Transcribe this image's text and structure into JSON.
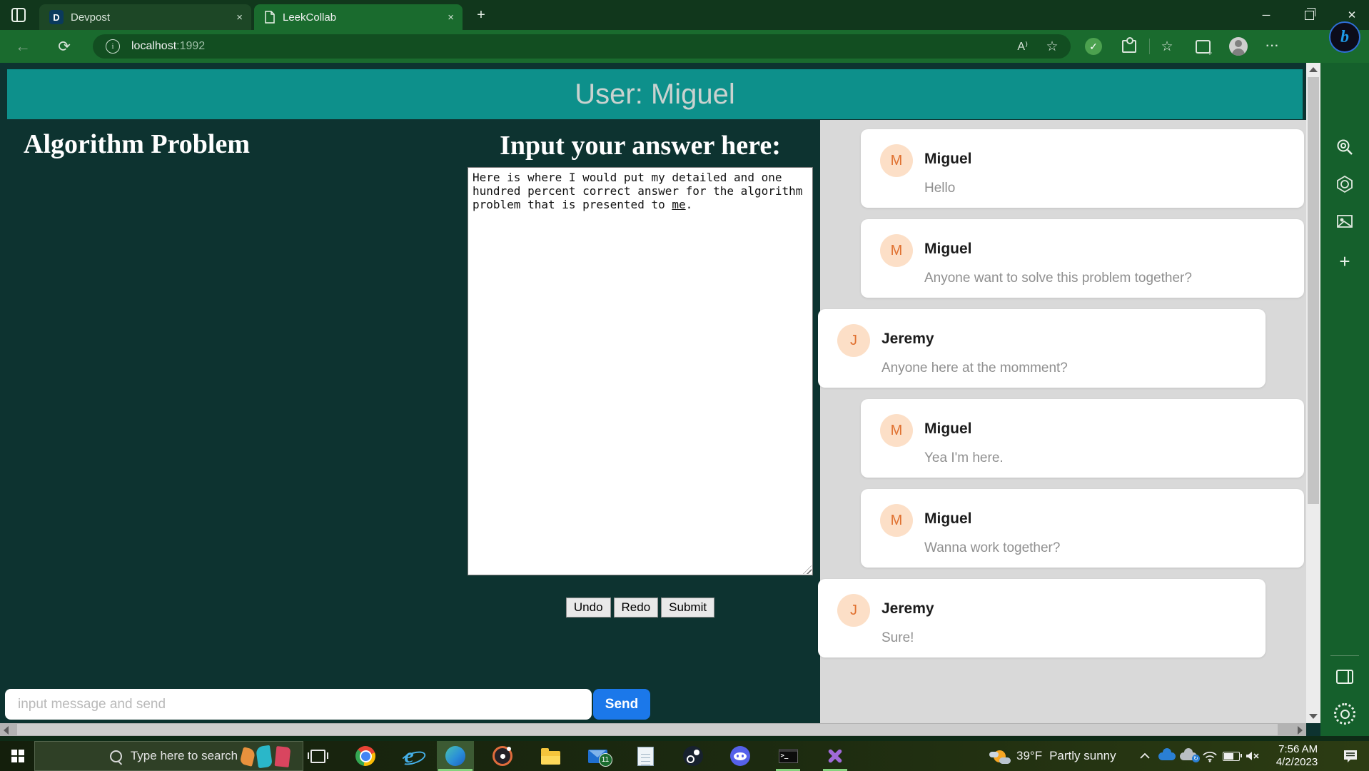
{
  "browser": {
    "tabs": [
      {
        "title": "Devpost",
        "favicon_letter": "D",
        "close": "×"
      },
      {
        "title": "LeekCollab",
        "close": "×"
      }
    ],
    "new_tab_label": "+",
    "url": {
      "host": "localhost",
      "port": ":1992"
    },
    "toolbar": {
      "back": "←",
      "refresh": "⟳",
      "read_aloud": "A⁾",
      "more_dots": "···",
      "bing_letter": "b",
      "check": "✓",
      "star": "☆",
      "star_list": "☆"
    },
    "window_controls": {
      "minimize": "─",
      "close": "✕"
    }
  },
  "page": {
    "user_header": "User: Miguel",
    "problem_title": "Algorithm Problem",
    "answer_heading": "Input your answer here:",
    "answer": {
      "before": "Here is where I would put my detailed and one hundred percent correct answer for the algorithm problem that is presented to ",
      "underlined": "me",
      "after": "."
    },
    "actions": {
      "undo": "Undo",
      "redo": "Redo",
      "submit": "Submit"
    },
    "chat_input": {
      "placeholder": "input message and send",
      "send": "Send"
    }
  },
  "chat": {
    "messages": [
      {
        "initial": "M",
        "author": "Miguel",
        "text": "Hello",
        "side": "right"
      },
      {
        "initial": "M",
        "author": "Miguel",
        "text": "Anyone want to solve this problem together?",
        "side": "right"
      },
      {
        "initial": "J",
        "author": "Jeremy",
        "text": "Anyone here at the momment?",
        "side": "left"
      },
      {
        "initial": "M",
        "author": "Miguel",
        "text": "Yea I'm here.",
        "side": "right"
      },
      {
        "initial": "M",
        "author": "Miguel",
        "text": "Wanna work together?",
        "side": "right"
      },
      {
        "initial": "J",
        "author": "Jeremy",
        "text": "Sure!",
        "side": "left"
      }
    ]
  },
  "taskbar": {
    "search_placeholder": "Type here to search",
    "mail_badge": "11",
    "terminal_prompt": ">_",
    "weather": {
      "temp": "39°F",
      "condition": "Partly sunny"
    },
    "clock": {
      "time": "7:56 AM",
      "date": "4/2/2023"
    }
  },
  "colors": {
    "chrome_green": "#1a6b2e",
    "page_teal_header": "#0d908b",
    "page_background": "#0d3330",
    "chat_panel": "#d9d9d9",
    "send_blue": "#1b78ea",
    "avatar_peach": "#fcdfc7"
  }
}
